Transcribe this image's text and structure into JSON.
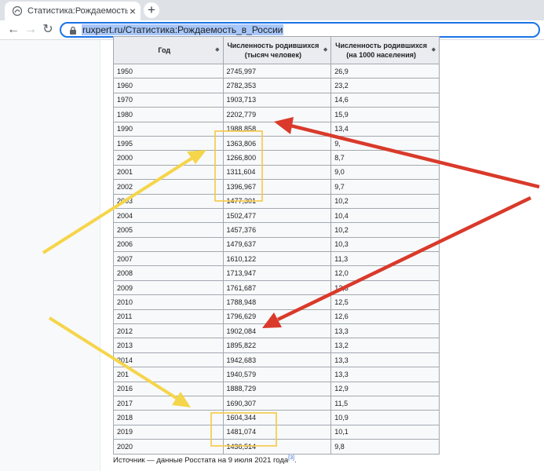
{
  "browser": {
    "tab_title": "Статистика:Рождаемость в Росс",
    "tab_close": "×",
    "new_tab": "+",
    "url": "ruxpert.ru/Статистика:Рождаемость_в_России"
  },
  "table": {
    "headers": [
      "Год",
      "Численность родившихся (тысяч человек)",
      "Численность родившихся (на 1000 населения)"
    ],
    "rows": [
      [
        "1950",
        "2745,997",
        "26,9"
      ],
      [
        "1960",
        "2782,353",
        "23,2"
      ],
      [
        "1970",
        "1903,713",
        "14,6"
      ],
      [
        "1980",
        "2202,779",
        "15,9"
      ],
      [
        "1990",
        "1988,858",
        "13,4"
      ],
      [
        "1995",
        "1363,806",
        "9,"
      ],
      [
        "2000",
        "1266,800",
        "8,7"
      ],
      [
        "2001",
        "1311,604",
        "9,0"
      ],
      [
        "2002",
        "1396,967",
        "9,7"
      ],
      [
        "2003",
        "1477,301",
        "10,2"
      ],
      [
        "2004",
        "1502,477",
        "10,4"
      ],
      [
        "2005",
        "1457,376",
        "10,2"
      ],
      [
        "2006",
        "1479,637",
        "10,3"
      ],
      [
        "2007",
        "1610,122",
        "11,3"
      ],
      [
        "2008",
        "1713,947",
        "12,0"
      ],
      [
        "2009",
        "1761,687",
        "12,3"
      ],
      [
        "2010",
        "1788,948",
        "12,5"
      ],
      [
        "2011",
        "1796,629",
        "12,6"
      ],
      [
        "2012",
        "1902,084",
        "13,3"
      ],
      [
        "2013",
        "1895,822",
        "13,2"
      ],
      [
        "2014",
        "1942,683",
        "13,3"
      ],
      [
        "201",
        "1940,579",
        "13,3"
      ],
      [
        "2016",
        "1888,729",
        "12,9"
      ],
      [
        "2017",
        "1690,307",
        "11,5"
      ],
      [
        "2018",
        "1604,344",
        "10,9"
      ],
      [
        "2019",
        "1481,074",
        "10,1"
      ],
      [
        "2020",
        "1436,514",
        "9,8"
      ]
    ],
    "separator_rows": [
      2,
      5,
      10,
      18
    ]
  },
  "source": {
    "text": "Источник — данные Росстата на 9 июля 2021 года",
    "ref": "[3]"
  },
  "colors": {
    "red_arrow": "#d93a2b",
    "yellow_arrow": "#f5d54a",
    "highlight_box": "#f5c842",
    "omnibox_focus": "#1a73e8"
  }
}
